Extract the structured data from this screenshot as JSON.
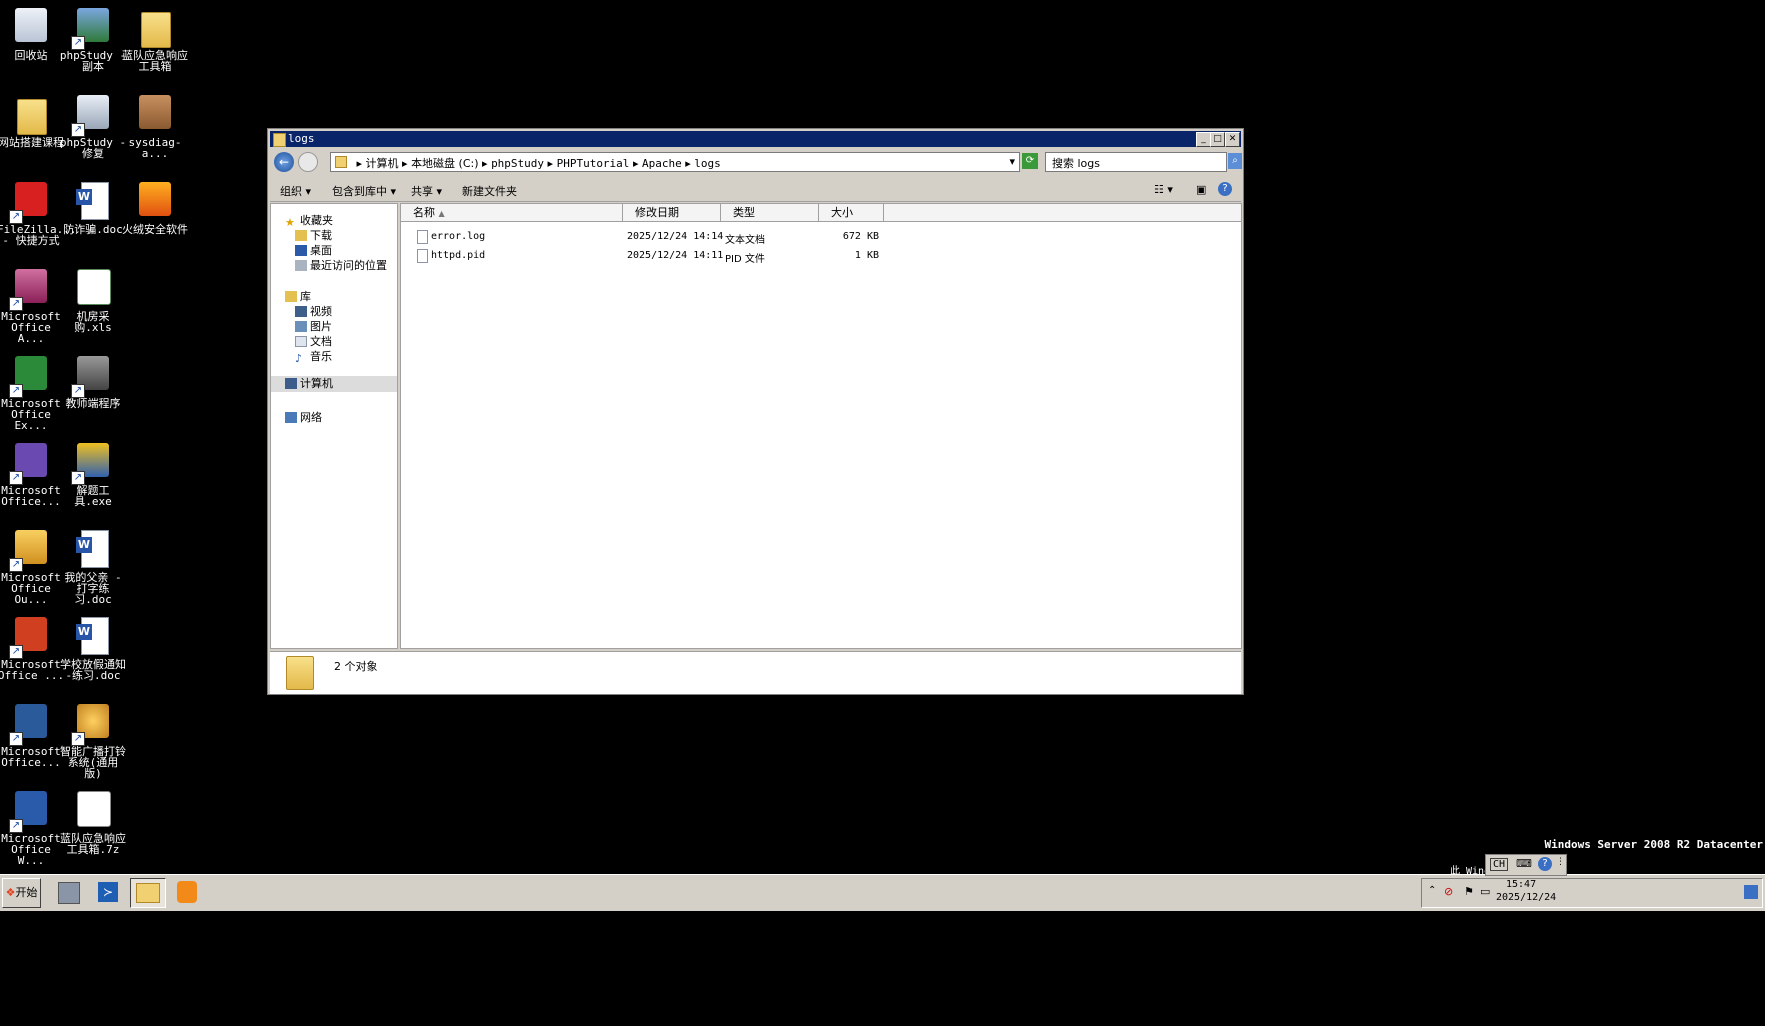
{
  "desktop": {
    "icons": [
      {
        "label": "回收站"
      },
      {
        "label": "phpStudy -\n副本"
      },
      {
        "label": "蓝队应急响应\n工具箱"
      },
      {
        "label": "网站搭建课程"
      },
      {
        "label": "phpStudy -\n修复"
      },
      {
        "label": "sysdiag-a..."
      },
      {
        "label": "FileZilla...\n- 快捷方式"
      },
      {
        "label": "防诈骗.doc"
      },
      {
        "label": "火绒安全软件"
      },
      {
        "label": "Microsoft\nOffice A..."
      },
      {
        "label": "机房采购.xls"
      },
      {
        "label": "Microsoft\nOffice Ex..."
      },
      {
        "label": "教师端程序"
      },
      {
        "label": "Microsoft\nOffice..."
      },
      {
        "label": "解题工具.exe"
      },
      {
        "label": "Microsoft\nOffice Ou..."
      },
      {
        "label": "我的父亲 -\n打字练习.doc"
      },
      {
        "label": "Microsoft\nOffice ..."
      },
      {
        "label": "学校放假通知\n-练习.doc"
      },
      {
        "label": "Microsoft\nOffice..."
      },
      {
        "label": "智能广播打铃\n系统(通用版)"
      },
      {
        "label": "Microsoft\nOffice W..."
      },
      {
        "label": "蓝队应急响应\n工具箱.7z"
      }
    ],
    "watermark": "Windows Server 2008 R2 Datacenter",
    "watermark_sub": "此 Wind"
  },
  "window": {
    "title": "logs",
    "breadcrumb": [
      "计算机",
      "本地磁盘 (C:)",
      "phpStudy",
      "PHPTutorial",
      "Apache",
      "logs"
    ],
    "search_placeholder": "搜索 logs",
    "toolbar": {
      "organize": "组织",
      "include": "包含到库中",
      "share": "共享",
      "new_folder": "新建文件夹"
    },
    "nav": {
      "favorites": "收藏夹",
      "downloads": "下载",
      "desktop": "桌面",
      "recent": "最近访问的位置",
      "libraries": "库",
      "videos": "视频",
      "pictures": "图片",
      "documents": "文档",
      "music": "音乐",
      "computer": "计算机",
      "network": "网络"
    },
    "columns": {
      "name": "名称",
      "modified": "修改日期",
      "type": "类型",
      "size": "大小"
    },
    "files": [
      {
        "name": "error.log",
        "modified": "2025/12/24 14:14",
        "type": "文本文档",
        "size": "672 KB"
      },
      {
        "name": "httpd.pid",
        "modified": "2025/12/24 14:11",
        "type": "PID 文件",
        "size": "1 KB"
      }
    ],
    "status": "2 个对象"
  },
  "taskbar": {
    "start": "开始",
    "lang": "CH",
    "time": "15:47",
    "date": "2025/12/24"
  }
}
